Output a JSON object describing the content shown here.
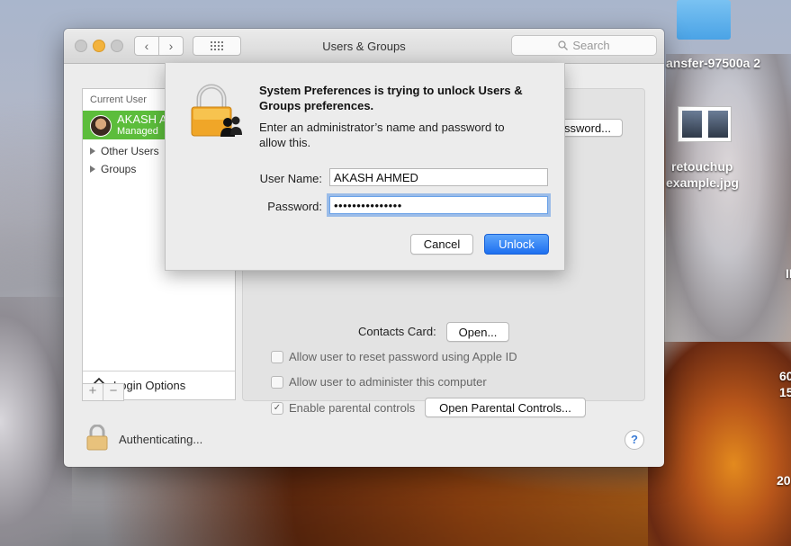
{
  "desktop": {
    "item1_label": "ansfer-97500a 2",
    "item2_label_line1": "retouchup",
    "item2_label_line2": "example.jpg",
    "right_edge_texts": [
      "II",
      "60",
      "15",
      "20"
    ]
  },
  "window": {
    "title": "Users & Groups",
    "search_placeholder": "Search",
    "sidebar": {
      "section_current": "Current User",
      "current_user_name": "AKASH A",
      "current_user_role": "Managed",
      "groups": [
        "Other Users",
        "Groups"
      ],
      "login_options": "Login Options",
      "add_label": "+",
      "remove_label": "−"
    },
    "panel": {
      "password_button_partial": "ssword...",
      "contacts_card_label": "Contacts Card:",
      "contacts_open_button": "Open...",
      "checkboxes": [
        {
          "label": "Allow user to reset password using Apple ID",
          "checked": false
        },
        {
          "label": "Allow user to administer this computer",
          "checked": false
        },
        {
          "label": "Enable parental controls",
          "checked": true
        }
      ],
      "parental_button": "Open Parental Controls..."
    },
    "footer_status": "Authenticating...",
    "help_label": "?"
  },
  "dialog": {
    "title": "System Preferences is trying to unlock Users & Groups preferences.",
    "message": "Enter an administrator’s name and password to allow this.",
    "username_label": "User Name:",
    "username_value": "AKASH AHMED",
    "password_label": "Password:",
    "password_value": "•••••••••••••••",
    "cancel_label": "Cancel",
    "unlock_label": "Unlock"
  }
}
